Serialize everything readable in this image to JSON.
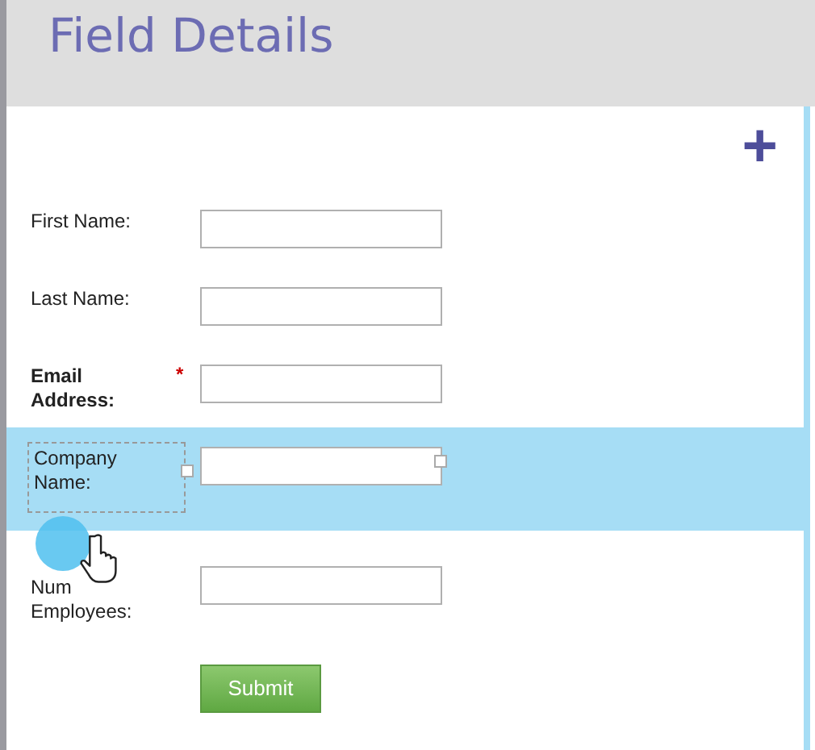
{
  "header": {
    "title": "Field Details"
  },
  "add_button": {
    "label": "+"
  },
  "fields": [
    {
      "label": "First Name:",
      "required": false,
      "selected": false
    },
    {
      "label": "Last Name:",
      "required": false,
      "selected": false
    },
    {
      "label": "Email Address:",
      "required": true,
      "required_mark": "*",
      "selected": false
    },
    {
      "label": "Company Name:",
      "required": false,
      "selected": true
    },
    {
      "label": "Num Employees:",
      "required": false,
      "selected": false
    }
  ],
  "submit": {
    "label": "Submit"
  }
}
